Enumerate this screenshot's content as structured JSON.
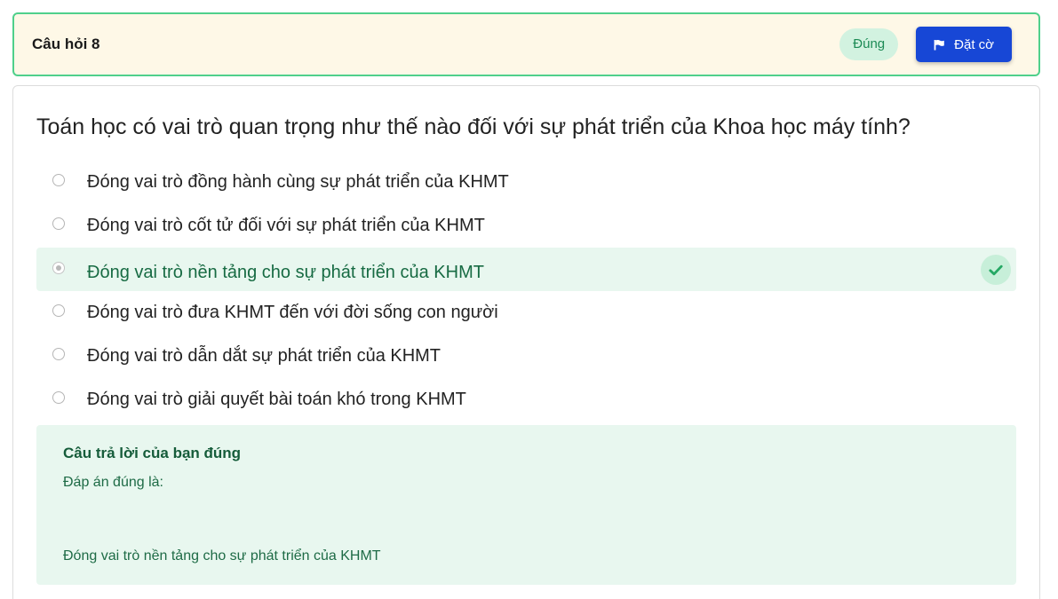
{
  "header": {
    "question_label": "Câu hỏi 8",
    "status": "Đúng",
    "flag_label": "Đặt cờ"
  },
  "question": {
    "text": "Toán học có vai trò quan trọng như thế nào đối với sự phát triển của Khoa học máy tính?",
    "options": [
      {
        "label": "Đóng vai trò đồng hành cùng sự phát triển của KHMT",
        "selected": false,
        "correct": false
      },
      {
        "label": "Đóng vai trò cốt tử đối với sự phát triển của KHMT",
        "selected": false,
        "correct": false
      },
      {
        "label": "Đóng vai trò nền tảng cho sự phát triển của KHMT",
        "selected": true,
        "correct": true
      },
      {
        "label": "Đóng vai trò đưa KHMT đến với đời sống con người",
        "selected": false,
        "correct": false
      },
      {
        "label": "Đóng vai trò dẫn dắt sự phát triển của KHMT",
        "selected": false,
        "correct": false
      },
      {
        "label": "Đóng vai trò giải quyết bài toán khó trong KHMT",
        "selected": false,
        "correct": false
      }
    ]
  },
  "feedback": {
    "title": "Câu trả lời của bạn đúng",
    "text": "Đáp án đúng là:",
    "answer": "Đóng vai trò nền tảng cho sự phát triển của KHMT"
  },
  "icons": {
    "flag": "flag-icon",
    "check": "check-icon"
  },
  "colors": {
    "header_border": "#4fd08b",
    "header_bg": "#fef8e7",
    "flag_button": "#1747d6",
    "correct_bg": "#e8f7ef",
    "correct_text": "#176b43"
  }
}
